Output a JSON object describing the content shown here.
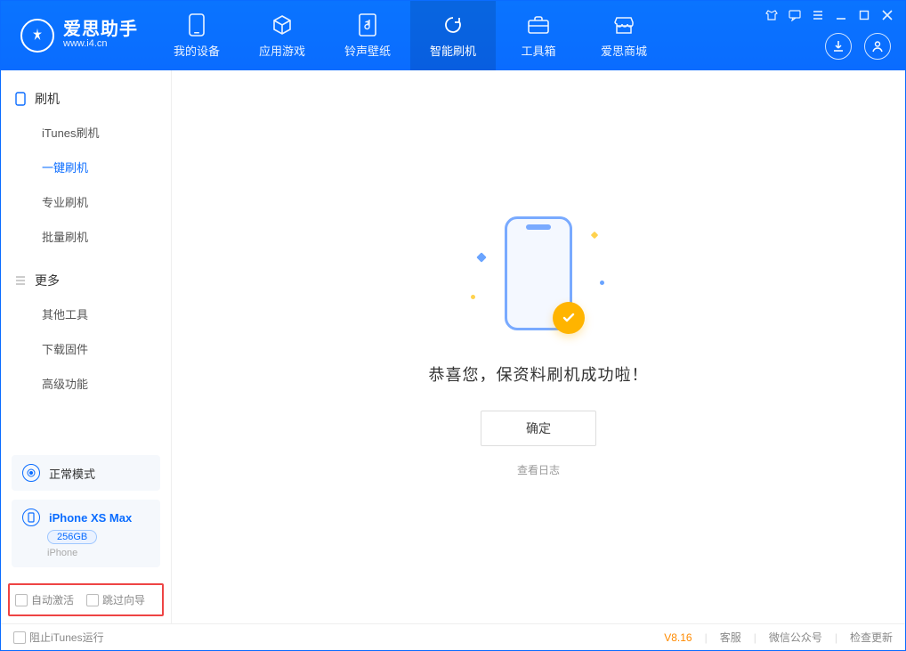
{
  "app": {
    "name_cn": "爱思助手",
    "name_en": "www.i4.cn"
  },
  "nav": {
    "tabs": [
      {
        "label": "我的设备"
      },
      {
        "label": "应用游戏"
      },
      {
        "label": "铃声壁纸"
      },
      {
        "label": "智能刷机"
      },
      {
        "label": "工具箱"
      },
      {
        "label": "爱思商城"
      }
    ]
  },
  "sidebar": {
    "group1_title": "刷机",
    "group1_items": [
      {
        "label": "iTunes刷机"
      },
      {
        "label": "一键刷机"
      },
      {
        "label": "专业刷机"
      },
      {
        "label": "批量刷机"
      }
    ],
    "group2_title": "更多",
    "group2_items": [
      {
        "label": "其他工具"
      },
      {
        "label": "下载固件"
      },
      {
        "label": "高级功能"
      }
    ],
    "mode_label": "正常模式",
    "device_name": "iPhone XS Max",
    "device_storage": "256GB",
    "device_type": "iPhone",
    "checkbox1": "自动激活",
    "checkbox2": "跳过向导"
  },
  "main": {
    "success_text": "恭喜您，保资料刷机成功啦！",
    "ok_button": "确定",
    "view_log": "查看日志"
  },
  "footer": {
    "block_itunes": "阻止iTunes运行",
    "version": "V8.16",
    "link1": "客服",
    "link2": "微信公众号",
    "link3": "检查更新"
  }
}
